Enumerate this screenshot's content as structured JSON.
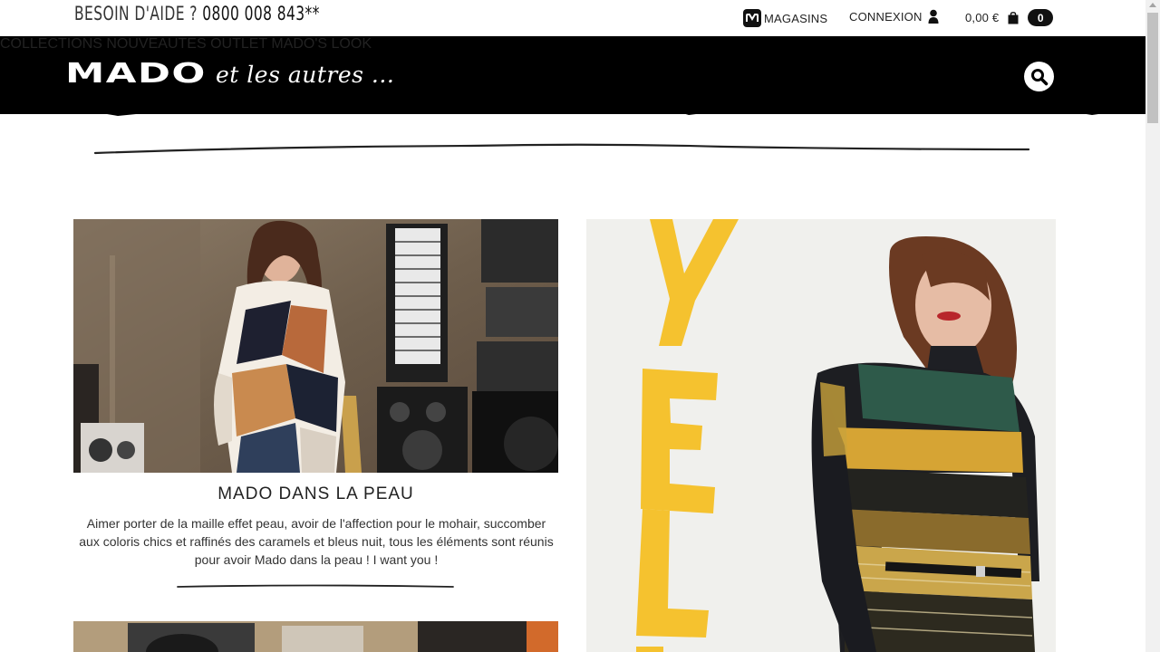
{
  "topbar": {
    "help_label": "BESOIN D'AIDE ?",
    "help_phone": "0800 008 843**",
    "stores_label": "MAGASINS",
    "login_label": "CONNEXION",
    "cart_total": "0,00 €",
    "cart_count": "0"
  },
  "header": {
    "logo_main": "MADO",
    "logo_sub": "et les autres ...",
    "nav": [
      "COLLECTIONS",
      "NOUVEAUTES",
      "OUTLET",
      "MADO'S LOOK"
    ]
  },
  "article": {
    "title": "MADO DANS LA PEAU",
    "text": "Aimer porter de la maille effet peau, avoir de l'affection pour le mohair, succomber aux coloris chics et raffinés des caramels et bleus nuit, tous les éléments sont réunis pour avoir Mado dans la peau ! I want you !"
  },
  "colors": {
    "header_bg": "#000000",
    "accent_yellow": "#f5c22f"
  }
}
